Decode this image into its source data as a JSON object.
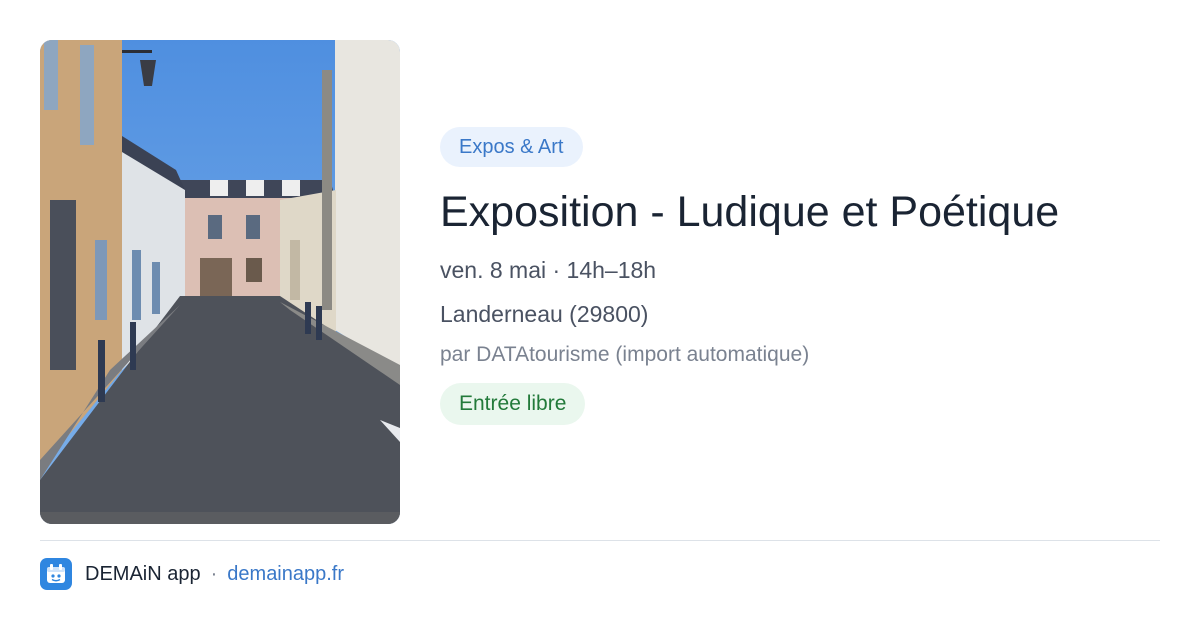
{
  "event": {
    "category": "Expos & Art",
    "title": "Exposition - Ludique et Poétique",
    "datetime": "ven. 8 mai · 14h–18h",
    "location": "Landerneau (29800)",
    "author": "par DATAtourisme (import automatique)",
    "price": "Entrée libre",
    "image": "street-photo",
    "colors": {
      "category_bg": "#eaf2fd",
      "category_text": "#3a78c8",
      "price_bg": "#eaf7ee",
      "price_text": "#227a3a"
    }
  },
  "footer": {
    "app_icon": "demain-logo-icon",
    "app_name": "DEMAiN app",
    "separator": "·",
    "website": "demainapp.fr"
  }
}
